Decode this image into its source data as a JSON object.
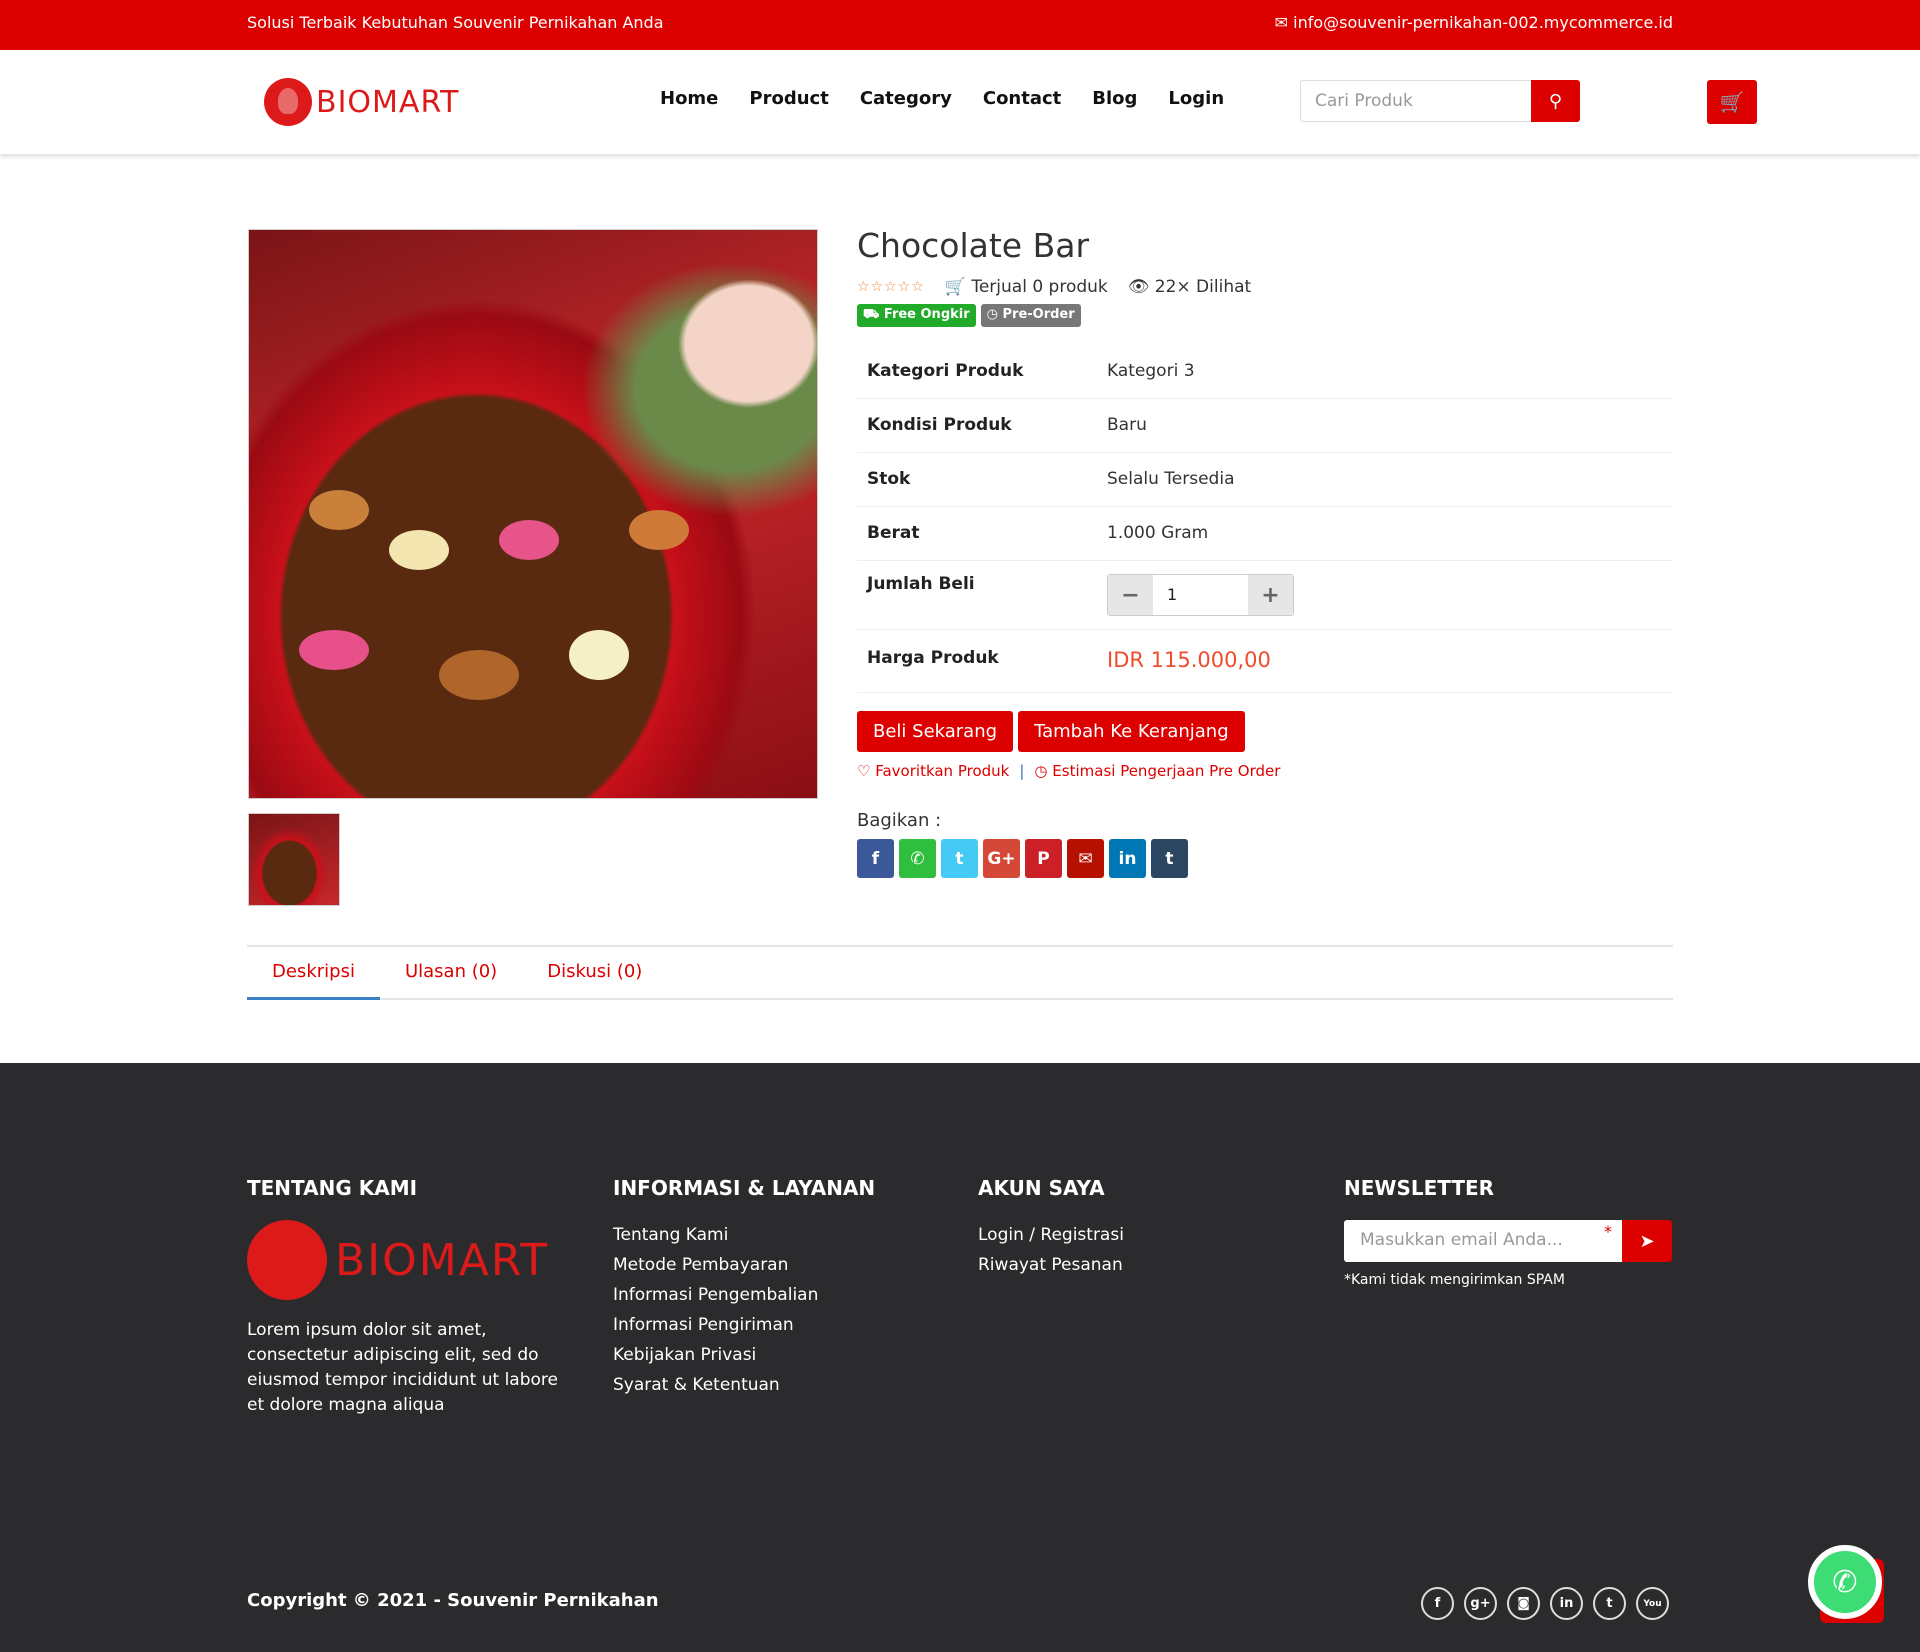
{
  "topbar": {
    "tagline": "Solusi Terbaik Kebutuhan Souvenir Pernikahan Anda",
    "email": "info@souvenir-pernikahan-002.mycommerce.id"
  },
  "header": {
    "logo": "BIOMART",
    "nav": [
      "Home",
      "Product",
      "Category",
      "Contact",
      "Blog",
      "Login"
    ],
    "search_placeholder": "Cari Produk"
  },
  "product": {
    "title": "Chocolate Bar",
    "rating": 0,
    "sold": "Terjual 0 produk",
    "views": "22× Dilihat",
    "badges": [
      "Free Ongkir",
      "Pre-Order"
    ],
    "specs": [
      {
        "k": "Kategori Produk",
        "v": "Kategori 3"
      },
      {
        "k": "Kondisi Produk",
        "v": "Baru"
      },
      {
        "k": "Stok",
        "v": "Selalu Tersedia"
      },
      {
        "k": "Berat",
        "v": "1.000 Gram"
      }
    ],
    "qty_label": "Jumlah Beli",
    "qty": "1",
    "price_label": "Harga Produk",
    "price": "IDR 115.000,00",
    "buy": "Beli Sekarang",
    "add_cart": "Tambah Ke Keranjang",
    "fav": "Favoritkan Produk",
    "estimate": "Estimasi Pengerjaan Pre Order",
    "share_label": "Bagikan :",
    "share": [
      {
        "icon": "f",
        "color": "#3b5998"
      },
      {
        "icon": "✆",
        "color": "#2fbe3e"
      },
      {
        "icon": "t",
        "color": "#45c9f5"
      },
      {
        "icon": "G+",
        "color": "#d34836"
      },
      {
        "icon": "P",
        "color": "#cb2027"
      },
      {
        "icon": "✉",
        "color": "#b51000"
      },
      {
        "icon": "in",
        "color": "#0077b5"
      },
      {
        "icon": "t",
        "color": "#2c4762"
      }
    ]
  },
  "tabs": [
    "Deskripsi",
    "Ulasan (0)",
    "Diskusi (0)"
  ],
  "footer": {
    "about_title": "TENTANG KAMI",
    "logo": "BIOMART",
    "about": "Lorem ipsum dolor sit amet, consectetur adipiscing elit, sed do eiusmod tempor incididunt ut labore et dolore magna aliqua",
    "info_title": "INFORMASI & LAYANAN",
    "info": [
      "Tentang Kami",
      "Metode Pembayaran",
      "Informasi Pengembalian",
      "Informasi Pengiriman",
      "Kebijakan Privasi",
      "Syarat & Ketentuan"
    ],
    "account_title": "AKUN SAYA",
    "account": [
      "Login / Registrasi",
      "Riwayat Pesanan"
    ],
    "news_title": "NEWSLETTER",
    "news_placeholder": "Masukkan email Anda...",
    "required": "*",
    "spam": "*Kami tidak mengirimkan SPAM",
    "copyright": "Copyright © 2021 - Souvenir Pernikahan",
    "social": [
      "f",
      "g+",
      "◙",
      "in",
      "t",
      "You"
    ]
  }
}
